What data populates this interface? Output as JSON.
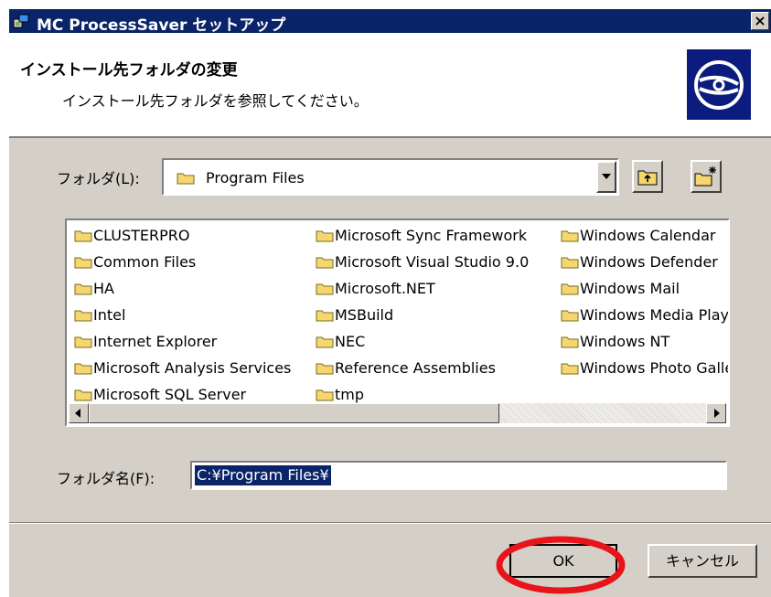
{
  "window": {
    "title": "MC ProcessSaver セットアップ",
    "close_glyph": "×"
  },
  "header": {
    "title": "インストール先フォルダの変更",
    "subtitle": "インストール先フォルダを参照してください。",
    "logo_icon": "cd-disc-icon"
  },
  "folder_select": {
    "label": "フォルダ(L):",
    "value": "Program Files",
    "up_button_icon": "folder-up-icon",
    "new_folder_icon": "new-folder-icon"
  },
  "folder_list": {
    "columns": [
      [
        "CLUSTERPRO",
        "Common Files",
        "HA",
        "Intel",
        "Internet Explorer",
        "Microsoft Analysis Services",
        "Microsoft SQL Server"
      ],
      [
        "Microsoft Sync Framework",
        "Microsoft Visual Studio 9.0",
        "Microsoft.NET",
        "MSBuild",
        "NEC",
        "Reference Assemblies",
        "tmp"
      ],
      [
        "Windows Calendar",
        "Windows Defender",
        "Windows Mail",
        "Windows Media Player",
        "Windows NT",
        "Windows Photo Gallery"
      ]
    ]
  },
  "folder_name": {
    "label": "フォルダ名(F):",
    "value": "C:¥Program Files¥"
  },
  "buttons": {
    "ok": "OK",
    "cancel": "キャンセル"
  },
  "colors": {
    "titlebar": "#0a246a",
    "annotation": "#e8141a",
    "folder": "#f5d76e"
  }
}
